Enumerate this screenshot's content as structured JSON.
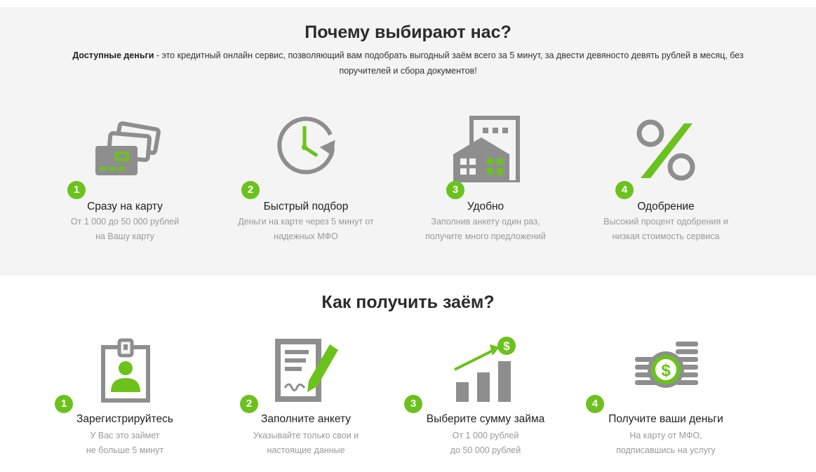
{
  "why": {
    "title": "Почему выбирают нас?",
    "intro_bold": "Доступные деньги",
    "intro_rest": " - это кредитный онлайн сервис, позволяющий вам подобрать выгодный заём всего за 5 минут, за двести девяносто девять рублей в месяц, без поручителей и сбора документов!",
    "features": [
      {
        "number": "1",
        "title": "Сразу на карту",
        "line1": "От 1 000 до 50 000 рублей",
        "line2": "на Вашу карту",
        "icon": "credit-cards-icon"
      },
      {
        "number": "2",
        "title": "Быстрый подбор",
        "line1": "Деньги на карте через 5 минут от",
        "line2": "надежных МФО",
        "icon": "clock-refresh-icon"
      },
      {
        "number": "3",
        "title": "Удобно",
        "line1": "Заполнив анкету один раз,",
        "line2": "получите много предложений",
        "icon": "buildings-icon"
      },
      {
        "number": "4",
        "title": "Одобрение",
        "line1": "Высокий процент одобрения и",
        "line2": "низкая стоимость сервиса",
        "icon": "percent-icon"
      }
    ]
  },
  "how": {
    "title": "Как получить заём?",
    "steps": [
      {
        "number": "1",
        "title": "Зарегистрируйтесь",
        "line1": "У Вас это займет",
        "line2": "не больше 5 минут",
        "icon": "id-badge-icon"
      },
      {
        "number": "2",
        "title": "Заполните анкету",
        "line1": "Указывайте только свои и",
        "line2": "настоящие данные",
        "icon": "form-pencil-icon"
      },
      {
        "number": "3",
        "title": "Выберите сумму займа",
        "line1": "От 1 000 рублей",
        "line2": "до 50 000 рублей",
        "icon": "growth-chart-icon"
      },
      {
        "number": "4",
        "title": "Получите ваши деньги",
        "line1": "На карту от МФО,",
        "line2": "подписавшись на услугу",
        "icon": "coins-stack-icon"
      }
    ]
  },
  "colors": {
    "accent": "#6cc21c",
    "icon_gray": "#8e8e8e",
    "section_bg": "#f4f4f4",
    "muted_text": "#999999"
  }
}
